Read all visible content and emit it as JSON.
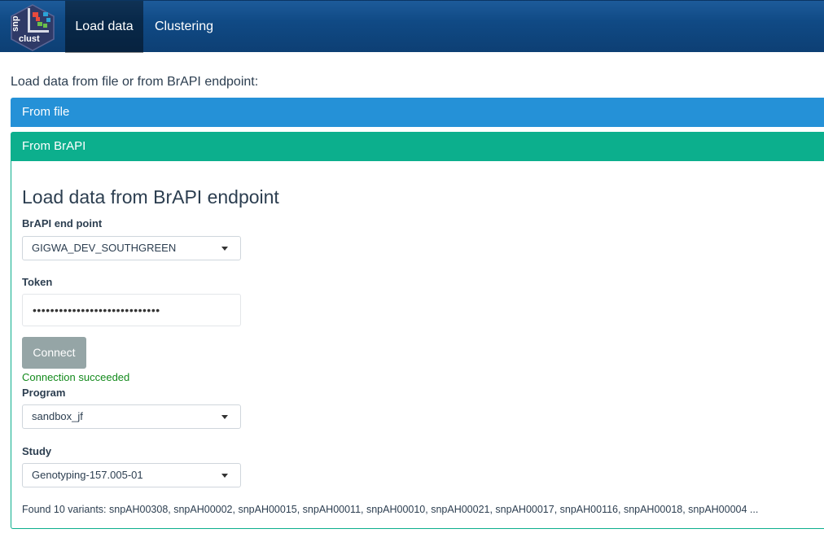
{
  "navbar": {
    "logo_text": [
      "snp",
      "clust"
    ],
    "tabs": [
      {
        "label": "Load data",
        "active": true
      },
      {
        "label": "Clustering",
        "active": false
      }
    ]
  },
  "intro": "Load data from file or from BrAPI endpoint:",
  "panels": {
    "file": {
      "title": "From file"
    },
    "brapi": {
      "title": "From BrAPI"
    }
  },
  "brapi_form": {
    "title": "Load data from BrAPI endpoint",
    "endpoint": {
      "label": "BrAPI end point",
      "value": "GIGWA_DEV_SOUTHGREEN"
    },
    "token": {
      "label": "Token",
      "value": "•••••••••••••••••••••••••••••"
    },
    "connect_label": "Connect",
    "status": "Connection succeeded",
    "program": {
      "label": "Program",
      "value": "sandbox_jf"
    },
    "study": {
      "label": "Study",
      "value": "Genotyping-157.005-01"
    },
    "found_text": "Found 10 variants: snpAH00308, snpAH00002, snpAH00015, snpAH00011, snpAH00010, snpAH00021, snpAH00017, snpAH00116, snpAH00018, snpAH00004 ..."
  },
  "colors": {
    "navbar": "#104a85",
    "from_file": "#2591d7",
    "from_brapi": "#0caf8d",
    "success": "#138a1c",
    "connect_button": "#95a5a6"
  }
}
